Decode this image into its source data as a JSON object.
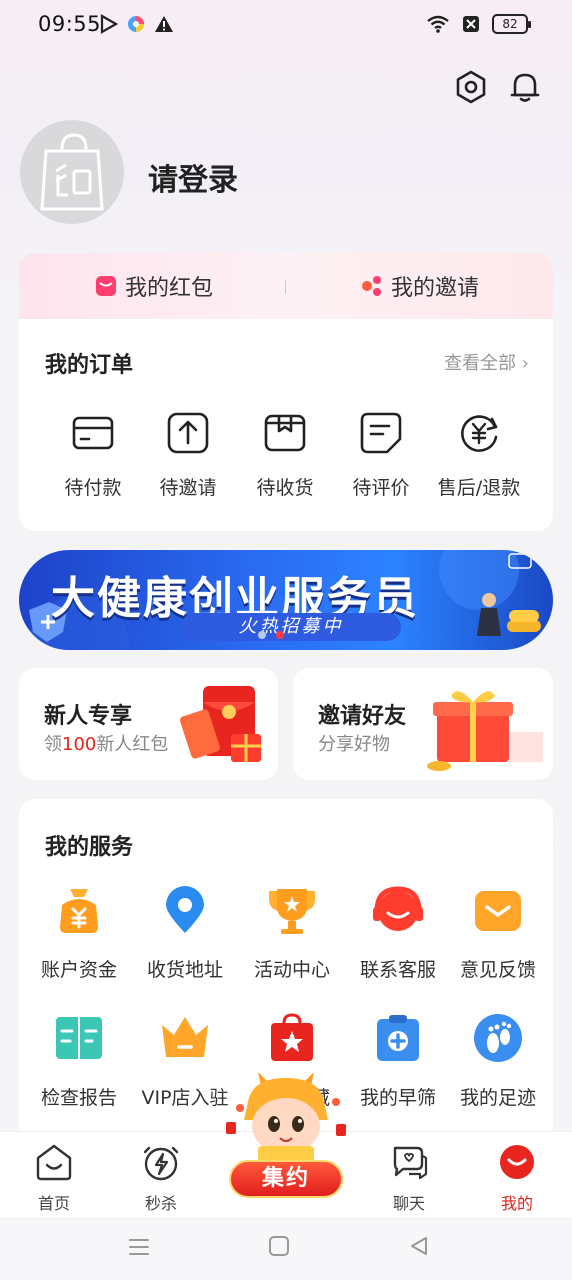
{
  "status_bar": {
    "time": "09:55",
    "battery": "82"
  },
  "profile": {
    "login_label": "请登录"
  },
  "wallet": {
    "red_packet_label": "我的红包",
    "invite_label": "我的邀请"
  },
  "orders": {
    "title": "我的订单",
    "view_all_label": "查看全部",
    "items": [
      {
        "label": "待付款",
        "icon": "card-icon"
      },
      {
        "label": "待邀请",
        "icon": "upload-icon"
      },
      {
        "label": "待收货",
        "icon": "box-icon"
      },
      {
        "label": "待评价",
        "icon": "note-icon"
      },
      {
        "label": "售后/退款",
        "icon": "refund-icon"
      }
    ]
  },
  "banner": {
    "title": "大健康创业服务员",
    "subtitle": "火热招募中"
  },
  "promos": [
    {
      "title": "新人专享",
      "sub_prefix": "领",
      "sub_highlight": "100",
      "sub_suffix": "新人红包"
    },
    {
      "title": "邀请好友",
      "sub_prefix": "分享好物",
      "sub_highlight": "",
      "sub_suffix": ""
    }
  ],
  "services": {
    "title": "我的服务",
    "items": [
      {
        "label": "账户资金",
        "icon": "money-bag-icon"
      },
      {
        "label": "收货地址",
        "icon": "location-icon"
      },
      {
        "label": "活动中心",
        "icon": "trophy-icon"
      },
      {
        "label": "联系客服",
        "icon": "headset-icon"
      },
      {
        "label": "意见反馈",
        "icon": "mail-icon"
      },
      {
        "label": "检查报告",
        "icon": "report-icon"
      },
      {
        "label": "VIP店入驻",
        "icon": "crown-icon"
      },
      {
        "label": "商品收藏",
        "icon": "favorite-bag-icon"
      },
      {
        "label": "我的早筛",
        "icon": "medical-clipboard-icon"
      },
      {
        "label": "我的足迹",
        "icon": "footprint-icon"
      }
    ]
  },
  "bottom_nav": {
    "items": [
      {
        "label": "首页",
        "icon": "home-icon"
      },
      {
        "label": "秒杀",
        "icon": "flash-sale-icon"
      },
      {
        "label": "集约",
        "icon": "jiyue-icon"
      },
      {
        "label": "聊天",
        "icon": "chat-icon"
      },
      {
        "label": "我的",
        "icon": "profile-icon"
      }
    ],
    "active_index": 4,
    "center_button_label": "集约"
  },
  "colors": {
    "accent_red": "#e1251b",
    "banner_blue": "#2a6cf2",
    "orange": "#ff9d1f"
  }
}
